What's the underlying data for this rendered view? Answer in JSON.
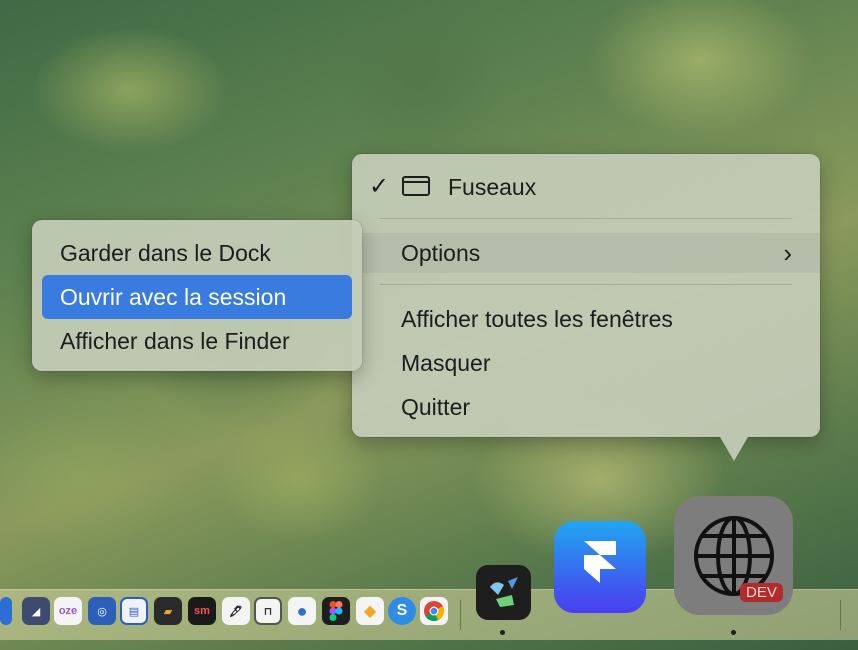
{
  "app_menu": {
    "window_item": {
      "checked": true,
      "label": "Fuseaux"
    },
    "options_label": "Options",
    "items": [
      "Afficher toutes les fenêtres",
      "Masquer",
      "Quitter"
    ]
  },
  "options_submenu": {
    "items": [
      "Garder dans le Dock",
      "Ouvrir avec la session",
      "Afficher dans le Finder"
    ],
    "highlighted": "Ouvrir avec la session"
  },
  "dock": {
    "selected_app_badge": "DEV",
    "colors": {
      "highlight": "#3a7be0",
      "badge": "#b22a2a"
    }
  },
  "icons": {
    "checkmark": "checkmark-icon",
    "window": "window-icon",
    "chevron": "chevron-right-icon"
  }
}
